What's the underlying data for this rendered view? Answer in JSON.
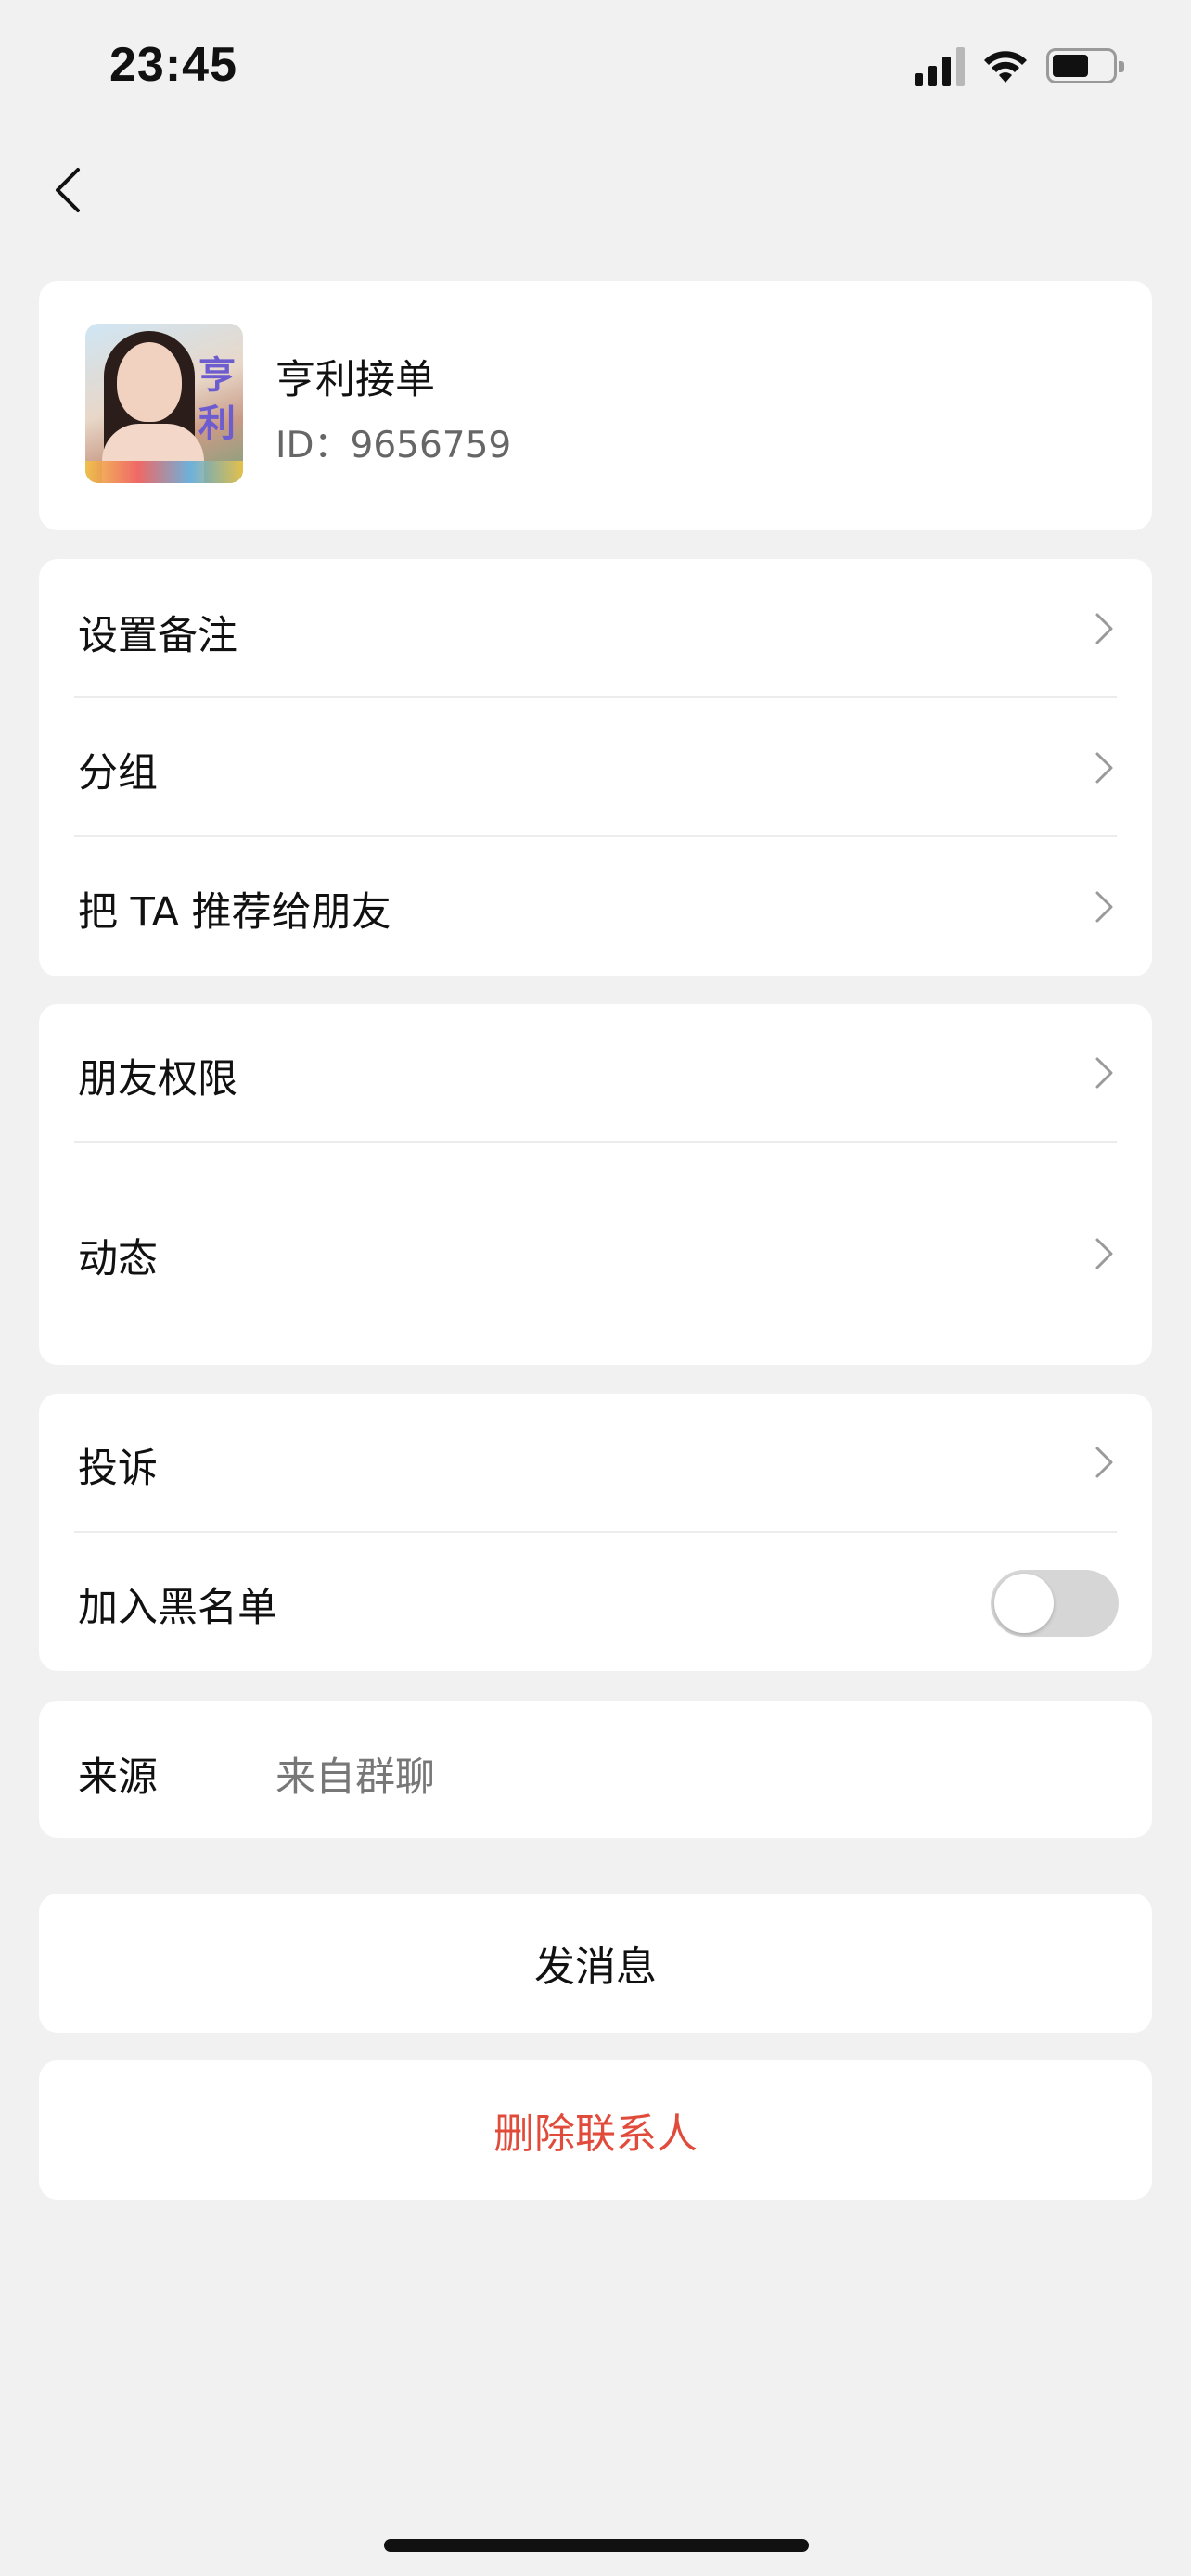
{
  "status_bar": {
    "time": "23:45",
    "battery_level": 0.55
  },
  "nav": {
    "back_icon": "chevron-left-icon"
  },
  "profile": {
    "name": "亨利接单",
    "id_text": "ID：9656759",
    "avatar_badge": "亨利"
  },
  "menu_group_1": [
    {
      "label": "设置备注"
    },
    {
      "label": "分组"
    },
    {
      "label": "把 TA 推荐给朋友"
    }
  ],
  "menu_group_2": [
    {
      "label": "朋友权限"
    },
    {
      "label": "动态"
    }
  ],
  "menu_group_3": {
    "complaint": "投诉",
    "blacklist": "加入黑名单",
    "blacklist_on": false
  },
  "source": {
    "label": "来源",
    "value": "来自群聊"
  },
  "actions": {
    "send_message": "发消息",
    "delete_contact": "删除联系人"
  },
  "colors": {
    "background": "#f1f1f1",
    "danger": "#e14b3b",
    "toggle_off": "#d6d6d6"
  }
}
